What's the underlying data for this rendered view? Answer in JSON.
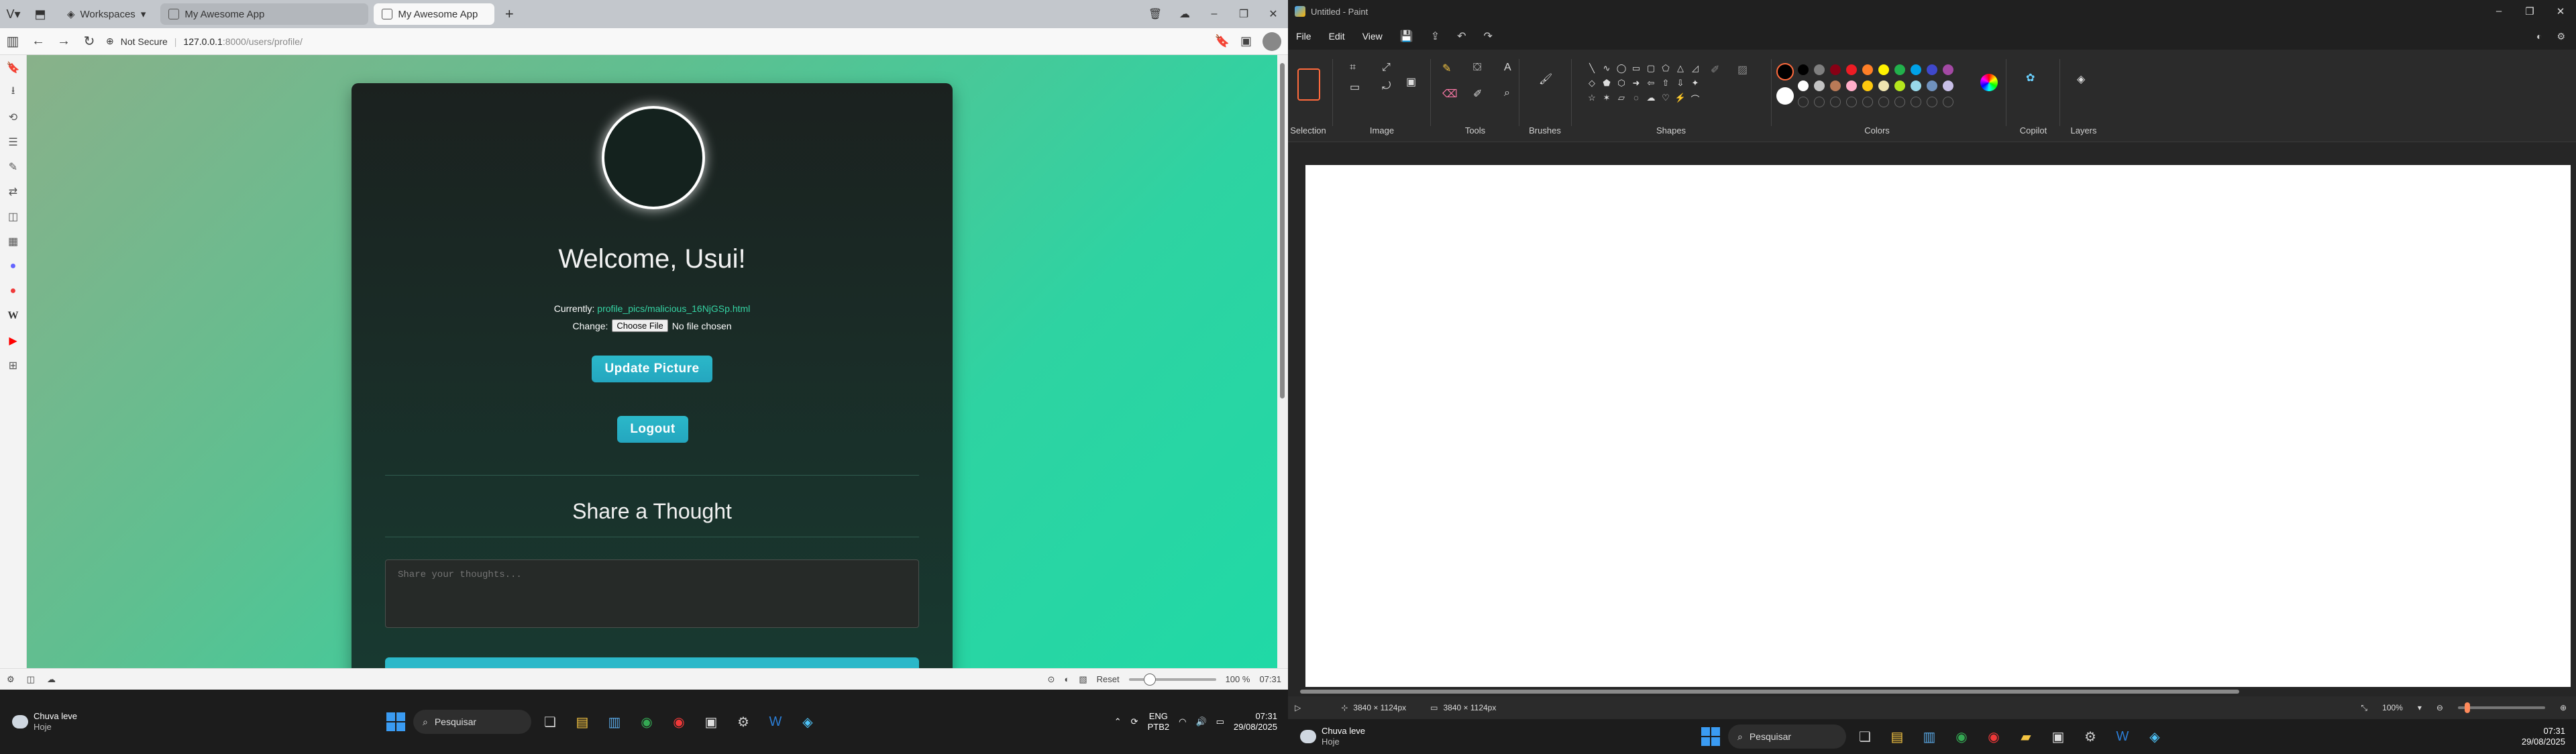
{
  "browser": {
    "workspaces_label": "Workspaces",
    "tabs": [
      {
        "title": "My Awesome App",
        "active": false
      },
      {
        "title": "My Awesome App",
        "active": true
      }
    ],
    "security_label": "Not Secure",
    "url_host": "127.0.0.1",
    "url_path": ":8000/users/profile/"
  },
  "page": {
    "welcome": "Welcome, Usui!",
    "currently_label": "Currently:",
    "current_pic": "profile_pics/malicious_16NjGSp.html",
    "change_label": "Change:",
    "choose_file": "Choose File",
    "no_file": "No file chosen",
    "update_button": "Update Picture",
    "logout_button": "Logout",
    "share_title": "Share a Thought",
    "thought_placeholder": "Share your thoughts..."
  },
  "browser_status": {
    "reset_label": "Reset",
    "zoom": "100 %",
    "time": "07:31"
  },
  "taskbar_left": {
    "weather_main": "Chuva leve",
    "weather_sub": "Hoje",
    "search_placeholder": "Pesquisar",
    "lang_top": "ENG",
    "lang_bottom": "PTB2",
    "time": "07:31",
    "date": "29/08/2025"
  },
  "paint": {
    "title": "Untitled - Paint",
    "menu": [
      "File",
      "Edit",
      "View"
    ],
    "groups": {
      "selection": "Selection",
      "image": "Image",
      "tools": "Tools",
      "brushes": "Brushes",
      "shapes": "Shapes",
      "colors": "Colors",
      "copilot": "Copilot",
      "layers": "Layers"
    },
    "palette": [
      "#000000",
      "#7f7f7f",
      "#880015",
      "#ed1c24",
      "#ff7f27",
      "#fff200",
      "#22b14c",
      "#00a2e8",
      "#3f48cc",
      "#a349a4",
      "#ffffff",
      "#c3c3c3",
      "#b97a57",
      "#ffaec9",
      "#ffc90e",
      "#efe4b0",
      "#b5e61d",
      "#99d9ea",
      "#7092be",
      "#c8bfe7"
    ],
    "primary_color": "#000000",
    "secondary_color": "#ffffff",
    "cursor_size": "3840 × 1124px",
    "canvas_size": "3840 × 1124px",
    "zoom": "100%"
  },
  "taskbar_right": {
    "weather_main": "Chuva leve",
    "weather_sub": "Hoje",
    "search_placeholder": "Pesquisar",
    "time": "07:31",
    "date": "29/08/2025"
  }
}
